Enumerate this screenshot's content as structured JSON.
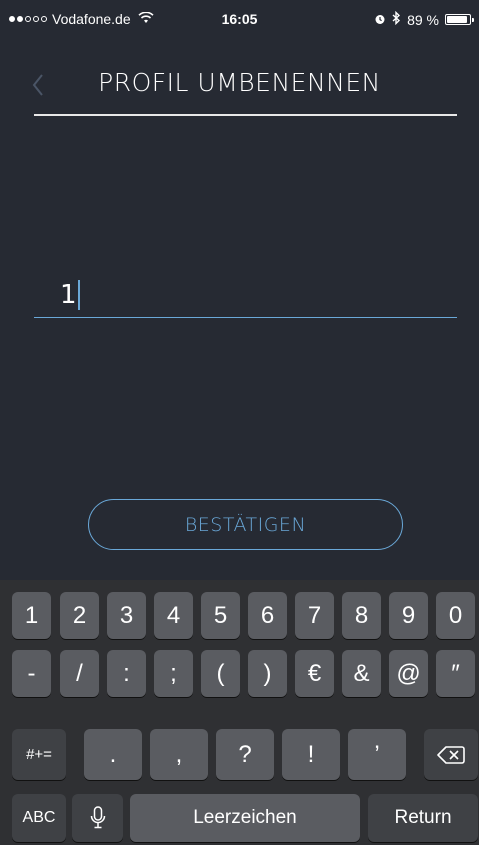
{
  "status_bar": {
    "carrier": "Vodafone.de",
    "time": "16:05",
    "battery_percent": "89 %",
    "battery_level": 0.89
  },
  "header": {
    "title": "PROFIL UMBENENNEN"
  },
  "form": {
    "name_value": "1"
  },
  "confirm_button": {
    "label": "BESTÄTIGEN"
  },
  "keyboard": {
    "row1": [
      "1",
      "2",
      "3",
      "4",
      "5",
      "6",
      "7",
      "8",
      "9",
      "0"
    ],
    "row2": [
      "-",
      "/",
      ":",
      ";",
      "(",
      ")",
      "€",
      "&",
      "@",
      "″"
    ],
    "row3": {
      "symbols_label": "#+=",
      "keys": [
        ".",
        ",",
        "?",
        "!",
        "’"
      ]
    },
    "row4": {
      "abc_label": "ABC",
      "space_label": "Leerzeichen",
      "return_label": "Return"
    }
  },
  "colors": {
    "background": "#262a33",
    "accent": "#6aa8d8",
    "keyboard_bg": "#2f3033",
    "key_bg": "#5a5c61"
  }
}
